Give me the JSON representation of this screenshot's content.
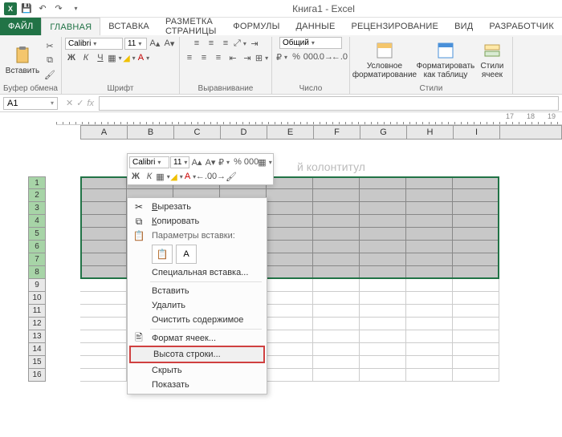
{
  "title": "Книга1 - Excel",
  "qat": {
    "save": "💾",
    "undo": "↶",
    "redo": "↷"
  },
  "tabs": {
    "file": "ФАЙЛ",
    "home": "ГЛАВНАЯ",
    "insert": "ВСТАВКА",
    "layout": "РАЗМЕТКА СТРАНИЦЫ",
    "formulas": "ФОРМУЛЫ",
    "data": "ДАННЫЕ",
    "review": "РЕЦЕНЗИРОВАНИЕ",
    "view": "ВИД",
    "developer": "РАЗРАБОТЧИК"
  },
  "ribbon": {
    "clipboard": {
      "paste": "Вставить",
      "label": "Буфер обмена"
    },
    "font": {
      "name": "Calibri",
      "size": "11",
      "label": "Шрифт"
    },
    "align": {
      "label": "Выравнивание"
    },
    "number": {
      "format": "Общий",
      "label": "Число"
    },
    "styles": {
      "cond": "Условное форматирование",
      "table": "Форматировать как таблицу",
      "cell": "Стили ячеек",
      "label": "Стили"
    }
  },
  "namebox": "A1",
  "fx": "fx",
  "cols": [
    "A",
    "B",
    "C",
    "D",
    "E",
    "F",
    "G",
    "H",
    "I"
  ],
  "rows": [
    1,
    2,
    3,
    4,
    5,
    6,
    7,
    8,
    9,
    10,
    11,
    12,
    13,
    14,
    15,
    16
  ],
  "selected_rows": [
    1,
    2,
    3,
    4,
    5,
    6,
    7,
    8
  ],
  "header_placeholder": "й колонтитул",
  "mini": {
    "font": "Calibri",
    "size": "11",
    "bold": "Ж",
    "italic": "К"
  },
  "ctx": {
    "cut": "Вырезать",
    "copy": "Копировать",
    "paste_opts": "Параметры вставки:",
    "paste_special": "Специальная вставка...",
    "insert": "Вставить",
    "delete": "Удалить",
    "clear": "Очистить содержимое",
    "format": "Формат ячеек...",
    "row_height": "Высота строки...",
    "hide": "Скрыть",
    "show": "Показать"
  },
  "ruler_nums": [
    "17",
    "18",
    "19"
  ]
}
